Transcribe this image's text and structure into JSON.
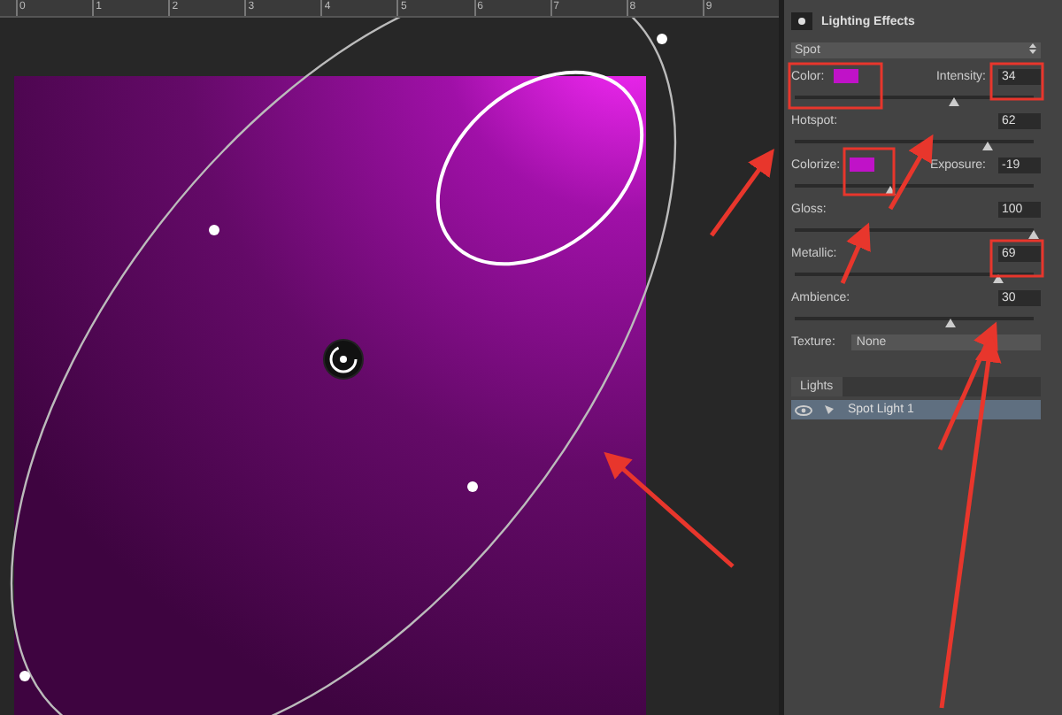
{
  "ruler": {
    "marks": [
      "0",
      "1",
      "2",
      "3",
      "4",
      "5",
      "6",
      "7",
      "8",
      "9"
    ]
  },
  "properties": {
    "title": "Lighting Effects",
    "preset": "Spot",
    "rows": [
      {
        "kind": "color",
        "label": "Color:",
        "color": "#c012c8",
        "label_2": "Intensity:",
        "value": "34",
        "level": 0.67
      },
      {
        "kind": "slider",
        "label": "Hotspot:",
        "value": "62",
        "level": 0.81
      },
      {
        "kind": "color",
        "label": "Colorize:",
        "color": "#c012c8",
        "label_2": "Exposure:",
        "value": "-19",
        "level": 0.4
      },
      {
        "kind": "slider",
        "label": "Gloss:",
        "value": "100",
        "level": 1
      },
      {
        "kind": "slider",
        "label": "Metallic:",
        "value": "69",
        "level": 0.85
      },
      {
        "kind": "slider",
        "label": "Ambience:",
        "value": "30",
        "level": 0.65
      },
      {
        "kind": "select",
        "label": "Texture:",
        "value": "None"
      }
    ]
  },
  "lights": {
    "tab": "Lights",
    "items": [
      {
        "name": "Spot Light 1",
        "selected": true,
        "visible": true
      }
    ]
  }
}
